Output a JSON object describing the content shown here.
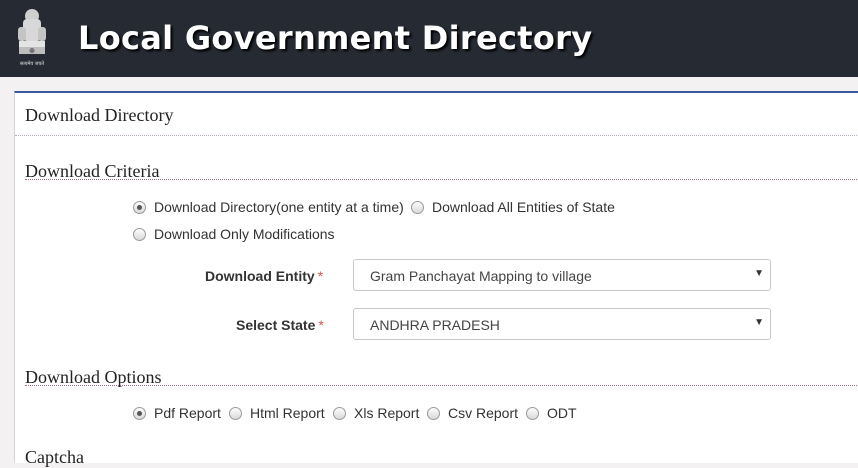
{
  "header": {
    "emblem_text": "सत्यमेव जयते",
    "title": "Local Government Directory"
  },
  "panel": {
    "title": "Download Directory"
  },
  "criteria": {
    "title": "Download Criteria",
    "options": [
      {
        "label": "Download Directory(one entity at a time)",
        "selected": true
      },
      {
        "label": "Download All Entities of State",
        "selected": false
      },
      {
        "label": "Download Only Modifications",
        "selected": false
      }
    ],
    "entity_label": "Download Entity",
    "entity_value": "Gram Panchayat Mapping to village",
    "state_label": "Select State",
    "state_value": "ANDHRA PRADESH",
    "required_mark": "*"
  },
  "options": {
    "title": "Download Options",
    "formats": [
      {
        "label": "Pdf Report",
        "selected": true
      },
      {
        "label": "Html Report",
        "selected": false
      },
      {
        "label": "Xls Report",
        "selected": false
      },
      {
        "label": "Csv Report",
        "selected": false
      },
      {
        "label": "ODT",
        "selected": false
      }
    ]
  },
  "captcha": {
    "title": "Captcha"
  },
  "icons": {
    "emblem": "national-emblem-icon",
    "dropdown": "caret-down-icon"
  },
  "colors": {
    "header_bg": "#262a33",
    "accent": "#3c5a99",
    "required": "#d9534f"
  }
}
